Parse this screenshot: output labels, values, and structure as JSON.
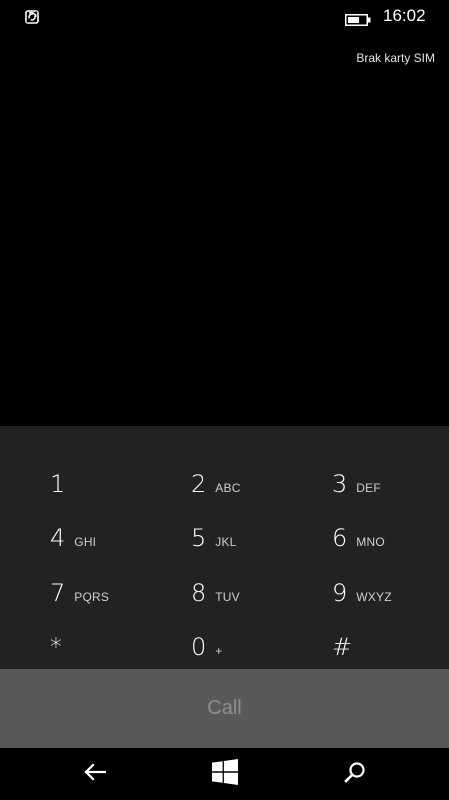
{
  "status_bar": {
    "time": "16:02",
    "battery_level": 0.65,
    "left_icon": "data-sense-icon",
    "sim_status": "Brak karty SIM"
  },
  "keypad": {
    "keys": [
      {
        "digit": "1",
        "letters": ""
      },
      {
        "digit": "2",
        "letters": "ABC"
      },
      {
        "digit": "3",
        "letters": "DEF"
      },
      {
        "digit": "4",
        "letters": "GHI"
      },
      {
        "digit": "5",
        "letters": "JKL"
      },
      {
        "digit": "6",
        "letters": "MNO"
      },
      {
        "digit": "7",
        "letters": "PQRS"
      },
      {
        "digit": "8",
        "letters": "TUV"
      },
      {
        "digit": "9",
        "letters": "WXYZ"
      },
      {
        "digit": "*",
        "letters": ""
      },
      {
        "digit": "0",
        "letters": "+"
      },
      {
        "digit": "#",
        "letters": ""
      }
    ]
  },
  "call": {
    "label": "Call"
  },
  "nav": {
    "back_icon": "back-arrow-icon",
    "start_icon": "windows-logo-icon",
    "search_icon": "search-icon"
  },
  "colors": {
    "background": "#000000",
    "keypad_background": "#222222",
    "call_background": "#595959",
    "call_text": "#8f8f8f"
  }
}
